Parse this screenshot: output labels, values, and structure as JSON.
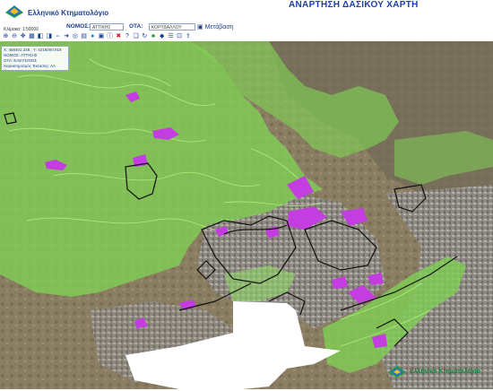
{
  "header": {
    "logo_text": "Ελληνικό Κτηματολόγιο",
    "title": "ΑΝΑΡΤΗΣΗ ΔΑΣΙΚΟΥ ΧΑΡΤΗ"
  },
  "navbar": {
    "nomos_label": "ΝΟΜΟΣ:",
    "nomos_value": "ΑΤΤΙΚΗΣ",
    "ota_label": "ΟΤΑ:",
    "ota_value": "ΚΟΡΥΔΑΛΛΟΥ",
    "go_label": "Μετάβαση"
  },
  "map": {
    "scale": "Κλίμακα: 1:50000",
    "info": {
      "coords": "Χ: 468401.348 , Y: 4216000.919",
      "nomos": "ΝΟΜΟΣ: ΑΤΤΙΚΗΣ",
      "ota": "ΟΤΑ: ΕΛΕΥΣΙΝΟΣ",
      "status": "Χαρακτηρισμός Έκτασης: ΑΑ"
    },
    "layers": {
      "forest_fill": "#7fcf55",
      "forest_outline": "#b6f27a",
      "objection_areas": "#c43de0",
      "boundary_lines": "#111111",
      "sea": "#ffffff"
    }
  },
  "toolbar": {
    "tools": [
      "zoom-in-icon",
      "zoom-out-icon",
      "pan-icon",
      "full-extent-icon",
      "previous-view-icon",
      "next-view-icon",
      "measure-icon",
      "identify-icon",
      "search-icon",
      "layers-icon",
      "globe-icon",
      "print-icon",
      "info-icon",
      "close-icon",
      "help-icon",
      "bookmark-icon",
      "refresh-icon",
      "tree-icon",
      "area-icon",
      "legend-icon",
      "ruler-icon",
      "export-icon"
    ]
  },
  "footer": {
    "logo_text": "Ελληνικό Κτηματολόγιο"
  }
}
